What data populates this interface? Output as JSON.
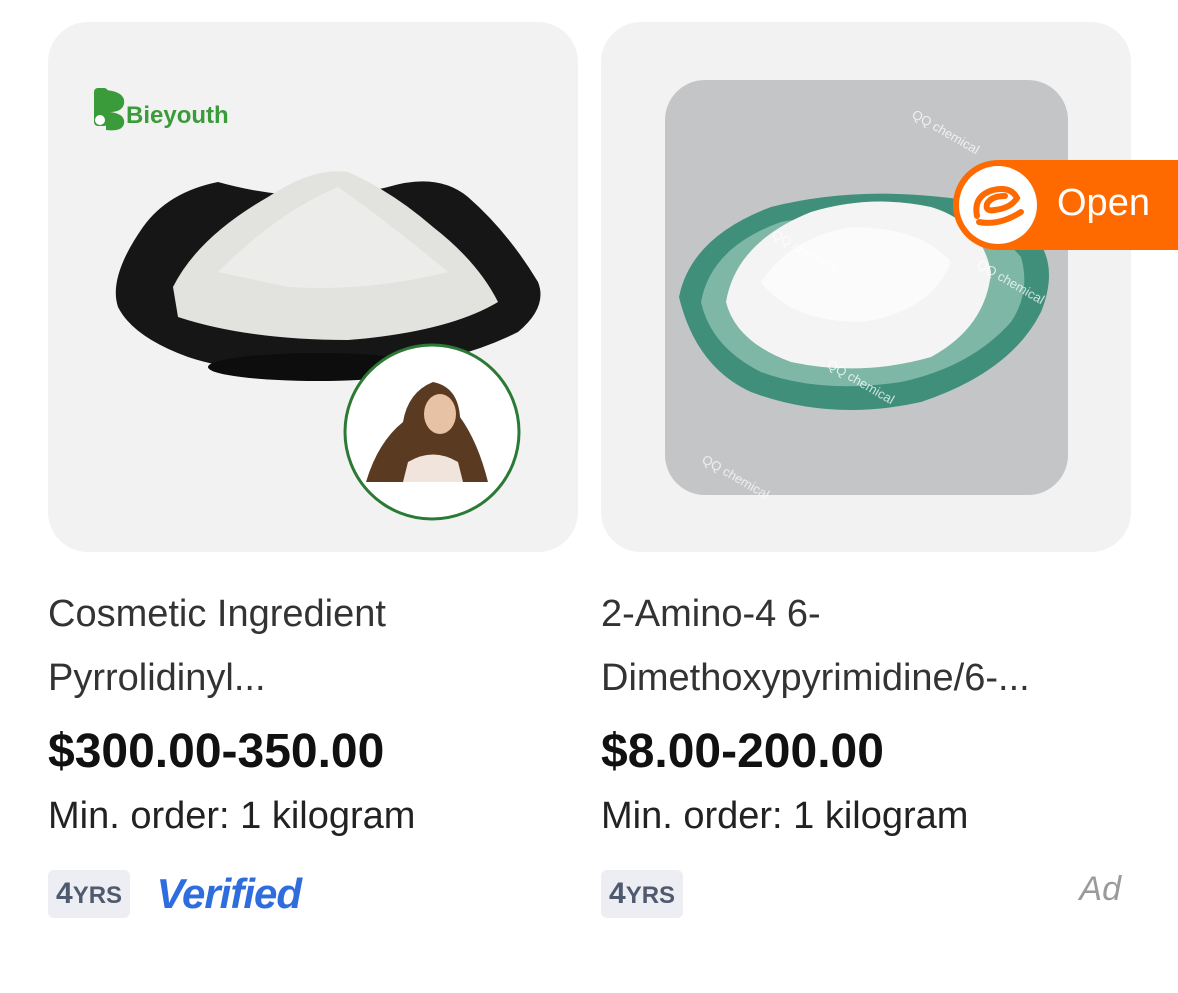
{
  "products": [
    {
      "brand_logo_text": "Bieyouth",
      "title_line1": "Cosmetic Ingredient",
      "title_line2": "Pyrrolidinyl...",
      "price": "$300.00-350.00",
      "min_order": "Min. order: 1 kilogram",
      "years": "4",
      "years_unit": "YRS",
      "verified_label": "Verified"
    },
    {
      "watermark_text": "QQ chemical",
      "title_line1": "2-Amino-4 6-",
      "title_line2": "Dimethoxypyrimidine/6-...",
      "price": "$8.00-200.00",
      "min_order": "Min. order: 1 kilogram",
      "years": "4",
      "years_unit": "YRS",
      "ad_label": "Ad"
    }
  ],
  "open_button": {
    "label": "Open",
    "icon": "alibaba-logo-icon",
    "color": "#ff6a00"
  },
  "colors": {
    "verified": "#2f6ddf",
    "badge_bg": "#eceef3",
    "card_bg": "#f2f2f2"
  }
}
